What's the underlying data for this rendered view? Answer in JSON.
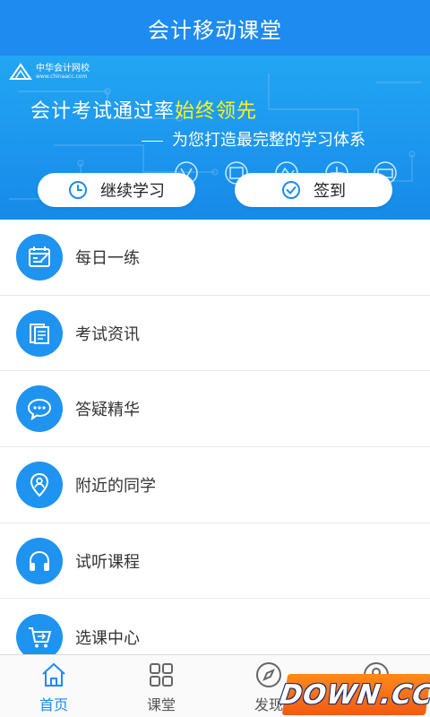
{
  "header": {
    "title": "会计移动课堂"
  },
  "banner": {
    "logo_name": "中华会计网校",
    "logo_url": "www.chinaacc.com",
    "slogan_prefix": "会计考试通过率",
    "slogan_highlight": "始终领先",
    "slogan_sub": "为您打造最完整的学习体系",
    "highlight_color": "#fff21a"
  },
  "actions": {
    "continue_label": "继续学习",
    "checkin_label": "签到"
  },
  "menu": {
    "items": [
      {
        "label": "每日一练",
        "icon": "calendar-icon"
      },
      {
        "label": "考试资讯",
        "icon": "document-icon"
      },
      {
        "label": "答疑精华",
        "icon": "chat-icon"
      },
      {
        "label": "附近的同学",
        "icon": "location-person-icon"
      },
      {
        "label": "试听课程",
        "icon": "headphones-icon"
      },
      {
        "label": "选课中心",
        "icon": "cart-icon"
      }
    ]
  },
  "tabbar": {
    "tabs": [
      {
        "label": "首页",
        "icon": "home-icon",
        "active": true
      },
      {
        "label": "课堂",
        "icon": "grid-icon",
        "active": false
      },
      {
        "label": "发现",
        "icon": "compass-icon",
        "active": false
      },
      {
        "label": "",
        "icon": "profile-icon",
        "active": false
      }
    ]
  },
  "watermark": {
    "text": "DOWN.CC"
  },
  "colors": {
    "primary": "#1e8bf0",
    "icon_bg": "#1f93f0"
  }
}
